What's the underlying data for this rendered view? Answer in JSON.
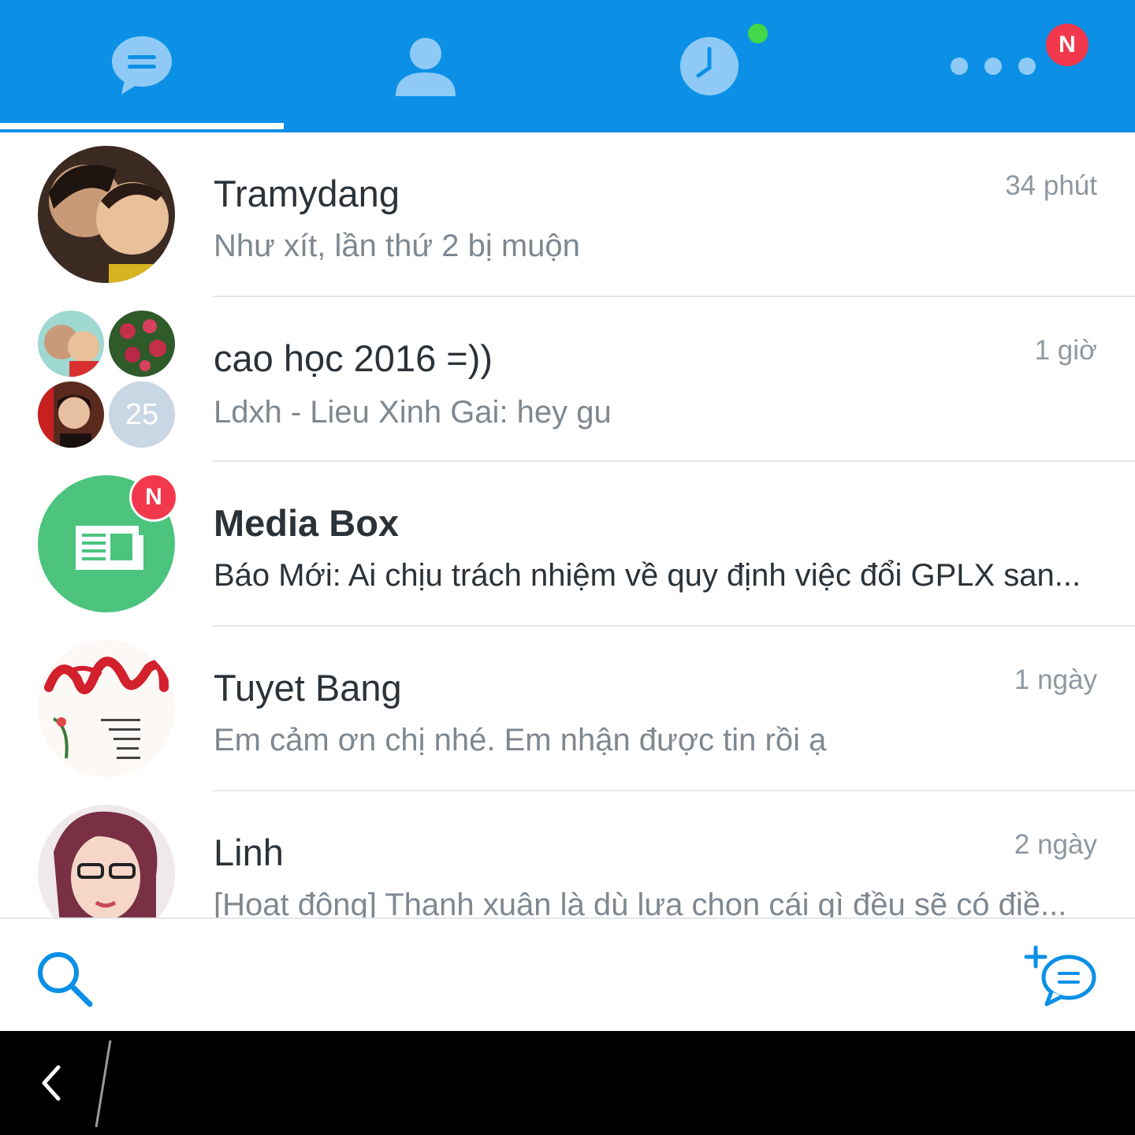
{
  "header": {
    "tabs": [
      {
        "icon": "chat-bubble-icon",
        "active": true
      },
      {
        "icon": "contacts-icon",
        "active": false
      },
      {
        "icon": "clock-icon",
        "active": false,
        "online_dot": true
      },
      {
        "icon": "more-dots-icon",
        "active": false,
        "badge": "N"
      }
    ],
    "colors": {
      "bar": "#0b90e6",
      "icon": "#8fcaf6",
      "badge": "#f2384c",
      "online": "#43d84a"
    }
  },
  "conversations": [
    {
      "name": "Tramydang",
      "preview": "Như xít, lần thứ 2 bị muộn",
      "time": "34 phút"
    },
    {
      "name": "cao học 2016 =))",
      "preview": "Ldxh - Lieu Xinh Gai: hey gu",
      "time": "1 giờ",
      "member_count": "25"
    },
    {
      "name": "Media Box",
      "preview": "Báo Mới: Ai chịu trách nhiệm về quy định việc đổi GPLX san...",
      "time": "",
      "badge": "N",
      "unread": true
    },
    {
      "name": "Tuyet Bang",
      "preview": "Em cảm ơn chị nhé. Em nhận được tin rồi ạ",
      "time": "1 ngày"
    },
    {
      "name": "Linh",
      "preview": "[Hoat đông] Thanh xuân là dù lưa chon cái gì đều sẽ có điề...",
      "time": "2 ngày"
    }
  ],
  "footer": {
    "search_icon": "search-icon",
    "compose_icon": "new-chat-icon"
  },
  "system_nav": {
    "back_icon": "back-chevron-icon"
  }
}
